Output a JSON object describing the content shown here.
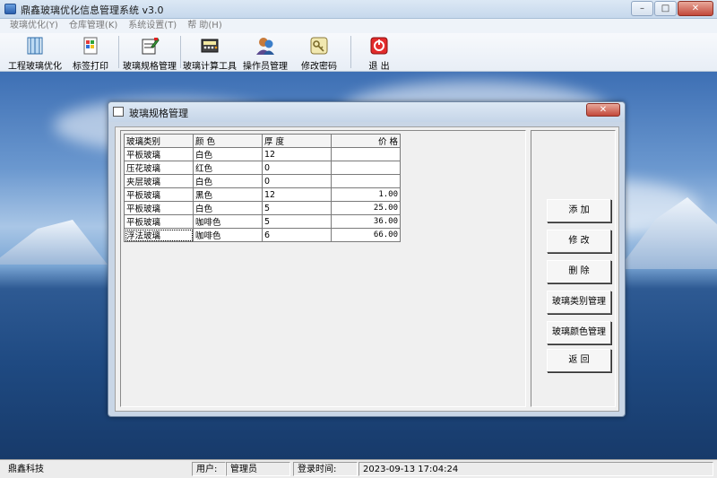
{
  "window": {
    "title": "鼎鑫玻璃优化信息管理系统 v3.0",
    "minimize": "–",
    "restore": "□",
    "close": "✕"
  },
  "menu": [
    "玻璃优化(Y)",
    "仓库管理(K)",
    "系统设置(T)",
    "帮 助(H)"
  ],
  "toolbar": [
    {
      "label": "工程玻璃优化",
      "icon": "book-icon"
    },
    {
      "label": "标签打印",
      "icon": "label-print-icon"
    },
    {
      "label": "玻璃规格管理",
      "icon": "spec-edit-icon"
    },
    {
      "label": "玻璃计算工具",
      "icon": "calculator-icon"
    },
    {
      "label": "操作员管理",
      "icon": "users-icon"
    },
    {
      "label": "修改密码",
      "icon": "key-icon"
    },
    {
      "label": "退 出",
      "icon": "exit-icon"
    }
  ],
  "dialog": {
    "title": "玻璃规格管理",
    "close": "✕",
    "columns": [
      "玻璃类别",
      "颜 色",
      "厚 度",
      "价 格"
    ],
    "rows": [
      [
        "平板玻璃",
        "白色",
        "12",
        ""
      ],
      [
        "压花玻璃",
        "红色",
        "0",
        ""
      ],
      [
        "夹层玻璃",
        "白色",
        "0",
        ""
      ],
      [
        "平板玻璃",
        "黑色",
        "12",
        "1.00"
      ],
      [
        "平板玻璃",
        "白色",
        "5",
        "25.00"
      ],
      [
        "平板玻璃",
        "咖啡色",
        "5",
        "36.00"
      ],
      [
        "浮法玻璃",
        "咖啡色",
        "6",
        "66.00"
      ]
    ],
    "buttons": {
      "add": "添 加",
      "edit": "修 改",
      "delete": "删 除",
      "category": "玻璃类别管理",
      "color": "玻璃颜色管理",
      "back": "返 回"
    }
  },
  "statusbar": {
    "company": "鼎鑫科技",
    "user_label": "用户:",
    "user_value": "管理员",
    "login_label": "登录时间:",
    "login_value": "2023-09-13 17:04:24"
  }
}
